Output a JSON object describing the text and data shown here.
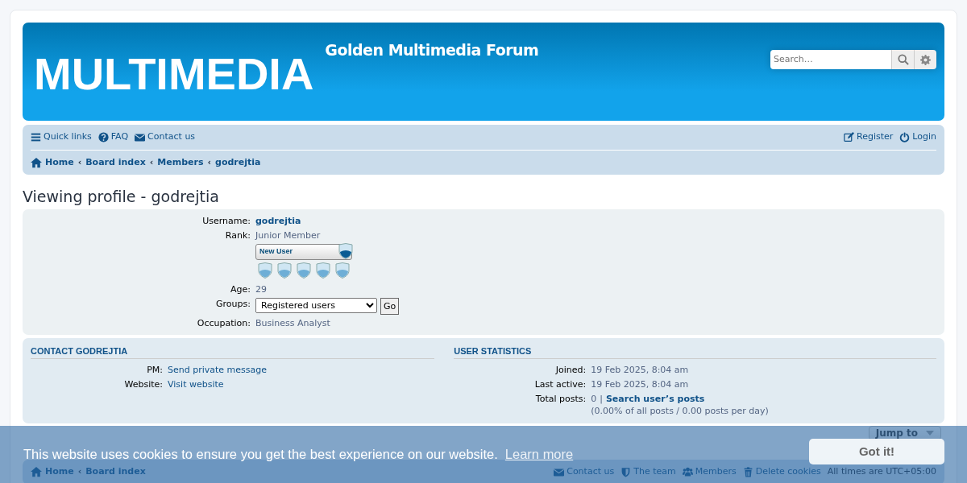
{
  "header": {
    "logo": "MULTIMEDIA",
    "site_title": "Golden Multimedia Forum",
    "search": {
      "placeholder": "Search…"
    }
  },
  "nav": {
    "left": [
      {
        "label": "Quick links"
      },
      {
        "label": "FAQ"
      },
      {
        "label": "Contact us"
      }
    ],
    "right": [
      {
        "label": "Register"
      },
      {
        "label": "Login"
      }
    ],
    "breadcrumbs": [
      "Home",
      "‹",
      "Board index",
      "‹",
      "Members",
      "‹",
      "godrejtia"
    ]
  },
  "page_title": "Viewing profile - godrejtia",
  "profile": [
    {
      "kind": "username",
      "label": "Username:",
      "value": "godrejtia"
    },
    {
      "kind": "text",
      "label": "Rank:",
      "value": "Junior Member"
    },
    {
      "kind": "rank_image",
      "value": "New User"
    },
    {
      "kind": "text",
      "label": "Age:",
      "value": "29"
    },
    {
      "kind": "select",
      "label": "Groups:",
      "value": "Registered users",
      "button": "Go"
    },
    {
      "kind": "text",
      "label": "Occupation:",
      "value": "Business Analyst"
    }
  ],
  "contact": {
    "title": "CONTACT GODREJTIA",
    "rows": [
      {
        "label": "PM:",
        "value": "Send private message"
      },
      {
        "label": "Website:",
        "value": "Visit website"
      }
    ]
  },
  "statistics": {
    "title": "USER STATISTICS",
    "rows": [
      {
        "kind": "text",
        "label": "Joined:",
        "value": "19 Feb 2025, 8:04 am"
      },
      {
        "kind": "text",
        "label": "Last active:",
        "value": "19 Feb 2025, 8:04 am"
      },
      {
        "kind": "posts",
        "label": "Total posts:",
        "value": "0",
        "separator": "|",
        "link": "Search user’s posts",
        "note": "(0.00% of all posts / 0.00 posts per day)"
      }
    ]
  },
  "jump_to": "Jump to",
  "footer": {
    "breadcrumbs": [
      "Home",
      "‹",
      "Board index"
    ],
    "links": [
      {
        "label": "Contact us"
      },
      {
        "label": "The team"
      },
      {
        "label": "Members"
      },
      {
        "label": "Delete cookies"
      }
    ],
    "timezone": "All times are UTC+05:00"
  },
  "cookie_banner": {
    "message": "This website uses cookies to ensure you get the best experience on our website.",
    "link": "Learn more",
    "button": "Got it!"
  }
}
